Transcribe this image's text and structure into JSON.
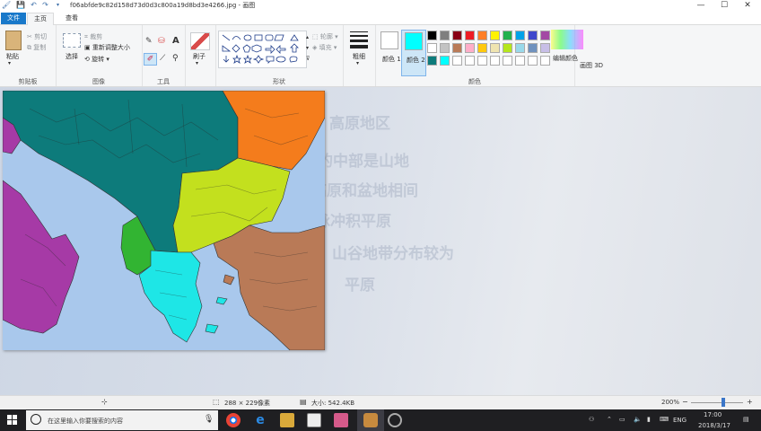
{
  "window": {
    "title": "f06abfde9c82d158d73d0d3c800a19d8bd3e4266.jpg - 画图",
    "controls": {
      "minimize": "—",
      "maximize": "☐",
      "close": "✕"
    }
  },
  "quick_access": {
    "save": "💾",
    "undo": "↶",
    "redo": "↷"
  },
  "tabs": [
    {
      "label": "文件"
    },
    {
      "label": "主页"
    },
    {
      "label": "查看"
    }
  ],
  "ribbon": {
    "clipboard": {
      "paste": "粘贴",
      "cut": "剪切",
      "copy": "复制",
      "group": "剪贴板"
    },
    "image": {
      "select": "选择",
      "crop": "裁剪",
      "resize": "重新调整大小",
      "rotate": "旋转",
      "group": "图像"
    },
    "tools": {
      "group": "工具",
      "text_tool": "A"
    },
    "brushes": {
      "label": "刷子"
    },
    "shapes": {
      "outline": "轮廓",
      "fill": "填充",
      "group": "形状"
    },
    "size": {
      "label": "粗细"
    },
    "colors": {
      "color1": "颜色 1",
      "color2": "颜色 2",
      "edit": "编辑颜色",
      "paint3d": "画图 3D",
      "group": "颜色",
      "color1_value": "#ffffff",
      "color2_value": "#00ffff",
      "palette": [
        "#000000",
        "#7f7f7f",
        "#880015",
        "#ed1c24",
        "#ff7f27",
        "#fff200",
        "#22b14c",
        "#00a2e8",
        "#3f48cc",
        "#a349a4",
        "#ffffff",
        "#c3c3c3",
        "#b97a57",
        "#ffaec9",
        "#ffc90e",
        "#efe4b0",
        "#b5e61d",
        "#99d9ea",
        "#7092be",
        "#c8bfe7",
        "#0d7b7b",
        "#00ffff",
        "#ffffff",
        "#ffffff",
        "#ffffff",
        "#ffffff",
        "#ffffff",
        "#ffffff",
        "#ffffff",
        "#ffffff"
      ]
    }
  },
  "overlay_text_lines": [
    "高原地区",
    "正中的中部是山地",
    "高原和盆地相间",
    "小型山脉冲积平原",
    "山谷地带分布较为",
    "平原"
  ],
  "map": {
    "regions": {
      "north": "#0d7b7b",
      "northeast": "#f47c1c",
      "center_east": "#c3e01e",
      "west_coast": "#32b432",
      "south": "#1ee6e6",
      "southeast": "#b97a57",
      "italy": "#a63aa6",
      "sea": "#a9c8ec"
    }
  },
  "statusbar": {
    "image_size": "288 × 229像素",
    "file_size": "大小: 542.4KB",
    "zoom": "200%"
  },
  "taskbar": {
    "search_placeholder": "在这里输入你要搜索的内容",
    "time": "17:00",
    "date": "2018/3/17",
    "lang": "ENG"
  }
}
